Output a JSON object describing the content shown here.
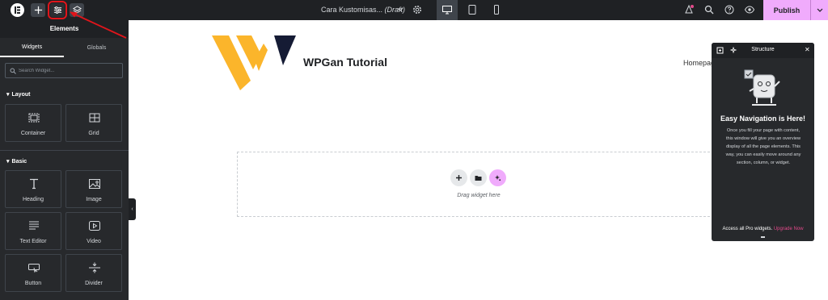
{
  "topbar": {
    "document_title": "Cara Kustomisas...",
    "document_status": "(Draft)",
    "publish_label": "Publish"
  },
  "sidebar": {
    "header": "Elements",
    "tabs": [
      "Widgets",
      "Globals"
    ],
    "search_placeholder": "Search Widget...",
    "sections": [
      {
        "title": "Layout",
        "widgets": [
          "Container",
          "Grid"
        ]
      },
      {
        "title": "Basic",
        "widgets": [
          "Heading",
          "Image",
          "Text Editor",
          "Video",
          "Button",
          "Divider"
        ]
      }
    ]
  },
  "canvas": {
    "site_name": "WPGan Tutorial",
    "nav_item": "Homepag",
    "dropzone_label": "Drag widget here"
  },
  "structure_panel": {
    "title": "Structure",
    "heading": "Easy Navigation is Here!",
    "body": "Once you fill your page with content, this window will give you an overview display of all the page elements. This way, you can easily move around any section, column, or widget.",
    "pro_text": "Access all Pro widgets.",
    "pro_link": "Upgrade Now"
  },
  "colors": {
    "accent_pink": "#f0abfc",
    "panel_dark": "#27292c",
    "highlight_red": "#e0151b",
    "logo_yellow": "#fbb52b",
    "logo_navy": "#151b34"
  }
}
